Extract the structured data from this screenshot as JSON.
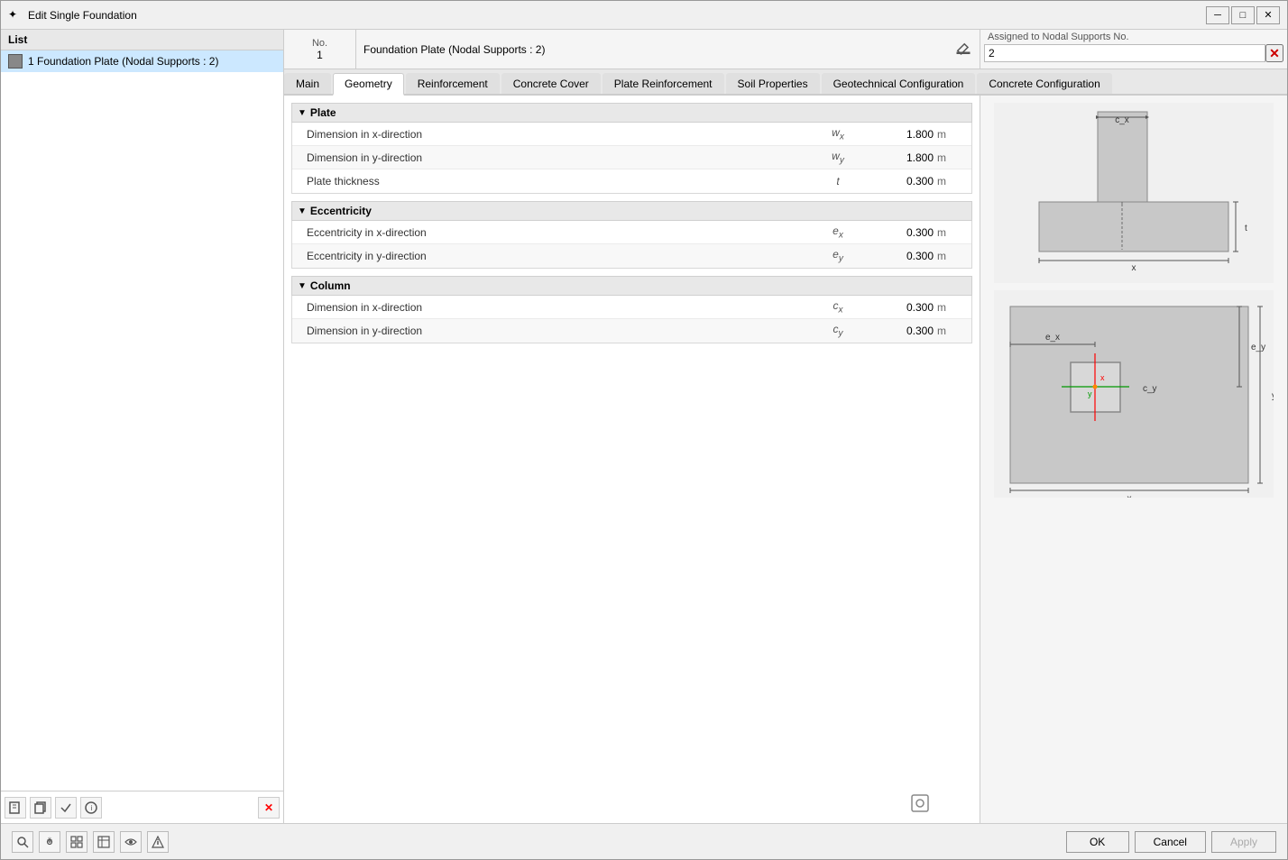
{
  "window": {
    "title": "Edit Single Foundation",
    "icon": "✦"
  },
  "left_panel": {
    "header": "List",
    "items": [
      {
        "id": 1,
        "label": "1  Foundation Plate (Nodal Supports : 2)",
        "selected": true
      }
    ]
  },
  "name_row": {
    "no_label": "No.",
    "no_value": "1",
    "name_value": "Foundation Plate (Nodal Supports : 2)",
    "assigned_label": "Assigned to Nodal Supports No.",
    "assigned_value": "2"
  },
  "tabs": [
    {
      "id": "main",
      "label": "Main",
      "active": false
    },
    {
      "id": "geometry",
      "label": "Geometry",
      "active": true
    },
    {
      "id": "reinforcement",
      "label": "Reinforcement",
      "active": false
    },
    {
      "id": "concrete_cover",
      "label": "Concrete Cover",
      "active": false
    },
    {
      "id": "plate_reinforcement",
      "label": "Plate Reinforcement",
      "active": false
    },
    {
      "id": "soil_properties",
      "label": "Soil Properties",
      "active": false
    },
    {
      "id": "geotechnical",
      "label": "Geotechnical Configuration",
      "active": false
    },
    {
      "id": "concrete_config",
      "label": "Concrete Configuration",
      "active": false
    }
  ],
  "sections": {
    "plate": {
      "title": "Plate",
      "rows": [
        {
          "label": "Dimension in x-direction",
          "symbol": "wx",
          "value": "1.800",
          "unit": "m"
        },
        {
          "label": "Dimension in y-direction",
          "symbol": "wy",
          "value": "1.800",
          "unit": "m"
        },
        {
          "label": "Plate thickness",
          "symbol": "t",
          "value": "0.300",
          "unit": "m"
        }
      ]
    },
    "eccentricity": {
      "title": "Eccentricity",
      "rows": [
        {
          "label": "Eccentricity in x-direction",
          "symbol": "ex",
          "value": "0.300",
          "unit": "m"
        },
        {
          "label": "Eccentricity in y-direction",
          "symbol": "ey",
          "value": "0.300",
          "unit": "m"
        }
      ]
    },
    "column": {
      "title": "Column",
      "rows": [
        {
          "label": "Dimension in x-direction",
          "symbol": "cx",
          "value": "0.300",
          "unit": "m"
        },
        {
          "label": "Dimension in y-direction",
          "symbol": "cy",
          "value": "0.300",
          "unit": "m"
        }
      ]
    }
  },
  "buttons": {
    "ok": "OK",
    "cancel": "Cancel",
    "apply": "Apply"
  }
}
